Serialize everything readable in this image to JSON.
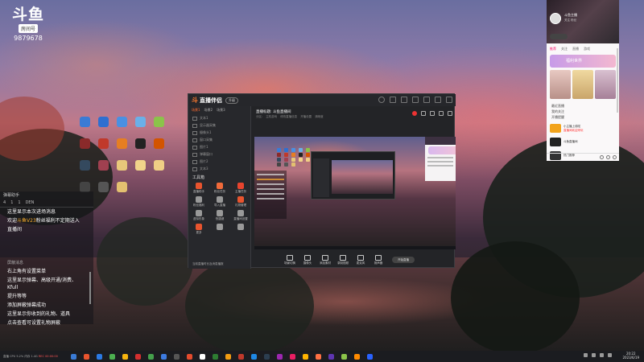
{
  "watermark": {
    "logo": "斗鱼",
    "badge": "房间号",
    "room_id": "9879678"
  },
  "desktop_icons": [
    {
      "name": "sogou",
      "label": "",
      "color": "#3a7bd5"
    },
    {
      "name": "star",
      "label": "",
      "color": "#2f6fd0"
    },
    {
      "name": "shield",
      "label": "",
      "color": "#4a90e2"
    },
    {
      "name": "globe",
      "label": "",
      "color": "#6ab0e8"
    },
    {
      "name": "leaf",
      "label": "",
      "color": "#8bc34a"
    },
    {
      "name": "game1",
      "label": "",
      "color": "#8a2a2a"
    },
    {
      "name": "game2",
      "label": "",
      "color": "#c0392b"
    },
    {
      "name": "game3",
      "label": "",
      "color": "#e67e22"
    },
    {
      "name": "capcut",
      "label": "",
      "color": "#222222"
    },
    {
      "name": "game4",
      "label": "",
      "color": "#d35400"
    },
    {
      "name": "app1",
      "label": "",
      "color": "#34495e"
    },
    {
      "name": "app2",
      "label": "",
      "color": "#a04050"
    },
    {
      "name": "folder1",
      "label": "",
      "color": "#e8c87a"
    },
    {
      "name": "folder2",
      "label": "",
      "color": "#f1d48a"
    },
    {
      "name": "folder3",
      "label": "",
      "color": "#f0ce85"
    },
    {
      "name": "app3",
      "label": "",
      "color": "#444444"
    },
    {
      "name": "app4",
      "label": "",
      "color": "#555555"
    },
    {
      "name": "folder4",
      "label": "",
      "color": "#e3c070"
    }
  ],
  "chat": {
    "header": "弹幕助手",
    "toolbar": [
      "4",
      "1",
      "1",
      "DEN"
    ],
    "lines": [
      {
        "prefix": "",
        "highlight": "",
        "text": "这里显示本次进场消息"
      },
      {
        "prefix": "欢迎",
        "highlight": "斗鱼V23",
        "text": "粉丝福利不定期送入"
      },
      {
        "prefix": "",
        "highlight": "",
        "text": "直播间"
      }
    ],
    "sub_header": "屏蔽消息",
    "lines2": [
      "右上角有设置菜单",
      "这里显示弹幕、高级开通/消费、Kfull",
      "提升等等",
      "添加屏蔽弹幕成功",
      "这里显示你收到的礼物、道具",
      "点击查看可设置礼物屏蔽"
    ]
  },
  "app": {
    "logo": "斗",
    "name": "直播伴侣",
    "version": "升级",
    "side_tabs": [
      "场景1",
      "场景2",
      "场景3"
    ],
    "scene_items": [
      "文本1",
      "显示器采集",
      "摄像头1",
      "窗口采集",
      "图片1",
      "弹幕窗口",
      "图片2",
      "文本3"
    ],
    "tools_title": "工具箱",
    "tools": [
      {
        "label": "直播助手",
        "color": "#e8542e"
      },
      {
        "label": "粉丝任务",
        "color": "#f06a3a"
      },
      {
        "label": "主播任务",
        "color": "#e8442e"
      },
      {
        "label": "粉丝福利",
        "color": "#999999"
      },
      {
        "label": "导入直播",
        "color": "#999999"
      },
      {
        "label": "礼物管理",
        "color": "#e8542e"
      },
      {
        "label": "虚拟形象",
        "color": "#999999"
      },
      {
        "label": "快捷键",
        "color": "#999999"
      },
      {
        "label": "直播间设置",
        "color": "#999999"
      },
      {
        "label": "更多",
        "color": "#e8542e"
      },
      {
        "label": "",
        "color": "#999999"
      },
      {
        "label": "",
        "color": "#999999"
      }
    ],
    "side_footer": "当前直播时长及消息播报",
    "room_title_label": "直播标题:",
    "room_title": "斗鱼直播间",
    "room_meta": [
      "分区:",
      "主机游戏",
      "修改直播信息",
      "开播设置",
      "清晰度"
    ],
    "controls": [
      {
        "label": "场景切换"
      },
      {
        "label": "摄像头"
      },
      {
        "label": "添加素材"
      },
      {
        "label": "录制视频"
      },
      {
        "label": "麦克风"
      },
      {
        "label": "扬声器"
      }
    ],
    "live_button": "开始直播"
  },
  "phone": {
    "anchor_name": "斗鱼主播",
    "anchor_sub": "关注 粉丝",
    "tabs": [
      "推荐",
      "关注",
      "直播",
      "游戏"
    ],
    "banner": "福利世界",
    "list": [
      "最近直播",
      "我的关注",
      "开播提醒"
    ],
    "items": [
      {
        "title": "小主播上线啦",
        "sub": "直播间欢迎来玩",
        "color": "#f2a31b"
      },
      {
        "title": "斗鱼直播间",
        "sub": "",
        "color": "#222222"
      },
      {
        "title": "热门推荐",
        "sub": "",
        "color": "#333333"
      }
    ]
  },
  "taskbar": {
    "info": "直播 CPU 5.2% 内存 1.4G",
    "live_flag": "REC 00:00:00",
    "apps": [
      "#3a7bd5",
      "#e8542e",
      "#2b7ae4",
      "#4caf50",
      "#f6b40e",
      "#d32f2f",
      "#44a04c",
      "#3d7be0",
      "#555555",
      "#e34b2d",
      "#ffffff",
      "#2e7d32",
      "#f39c12",
      "#c0392b",
      "#1e88e5",
      "#2c3e50",
      "#9c27b0",
      "#e91e63",
      "#ffb300",
      "#ff7043",
      "#5e35b1",
      "#8bc34a",
      "#ff8a00",
      "#2962ff"
    ],
    "time": "20:22",
    "date": "2023/6/19"
  }
}
